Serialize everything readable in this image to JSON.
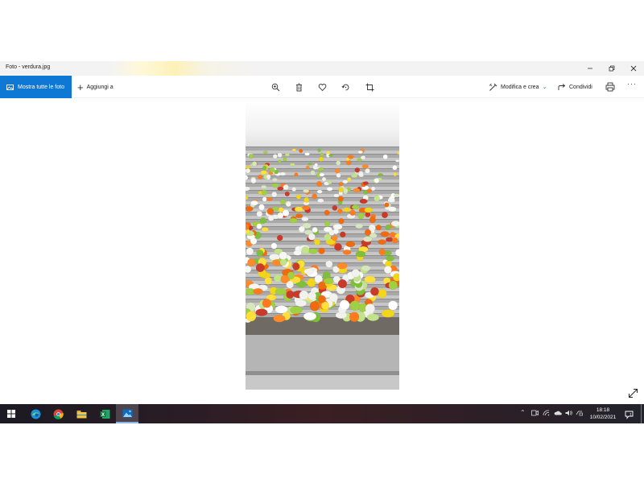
{
  "window": {
    "title": "Foto - verdura.jpg"
  },
  "toolbar": {
    "show_all_label": "Mostra tutte le foto",
    "add_to_label": "Aggiungi a",
    "edit_create_label": "Modifica e crea",
    "share_label": "Condividi",
    "more_label": "···"
  },
  "photo": {
    "subject": "vegetables"
  },
  "taskbar": {
    "time": "18:18",
    "date": "10/02/2021",
    "notification_count": "1"
  },
  "colors": {
    "accent": "#0f78d4",
    "taskbar": "#2a1e22"
  }
}
